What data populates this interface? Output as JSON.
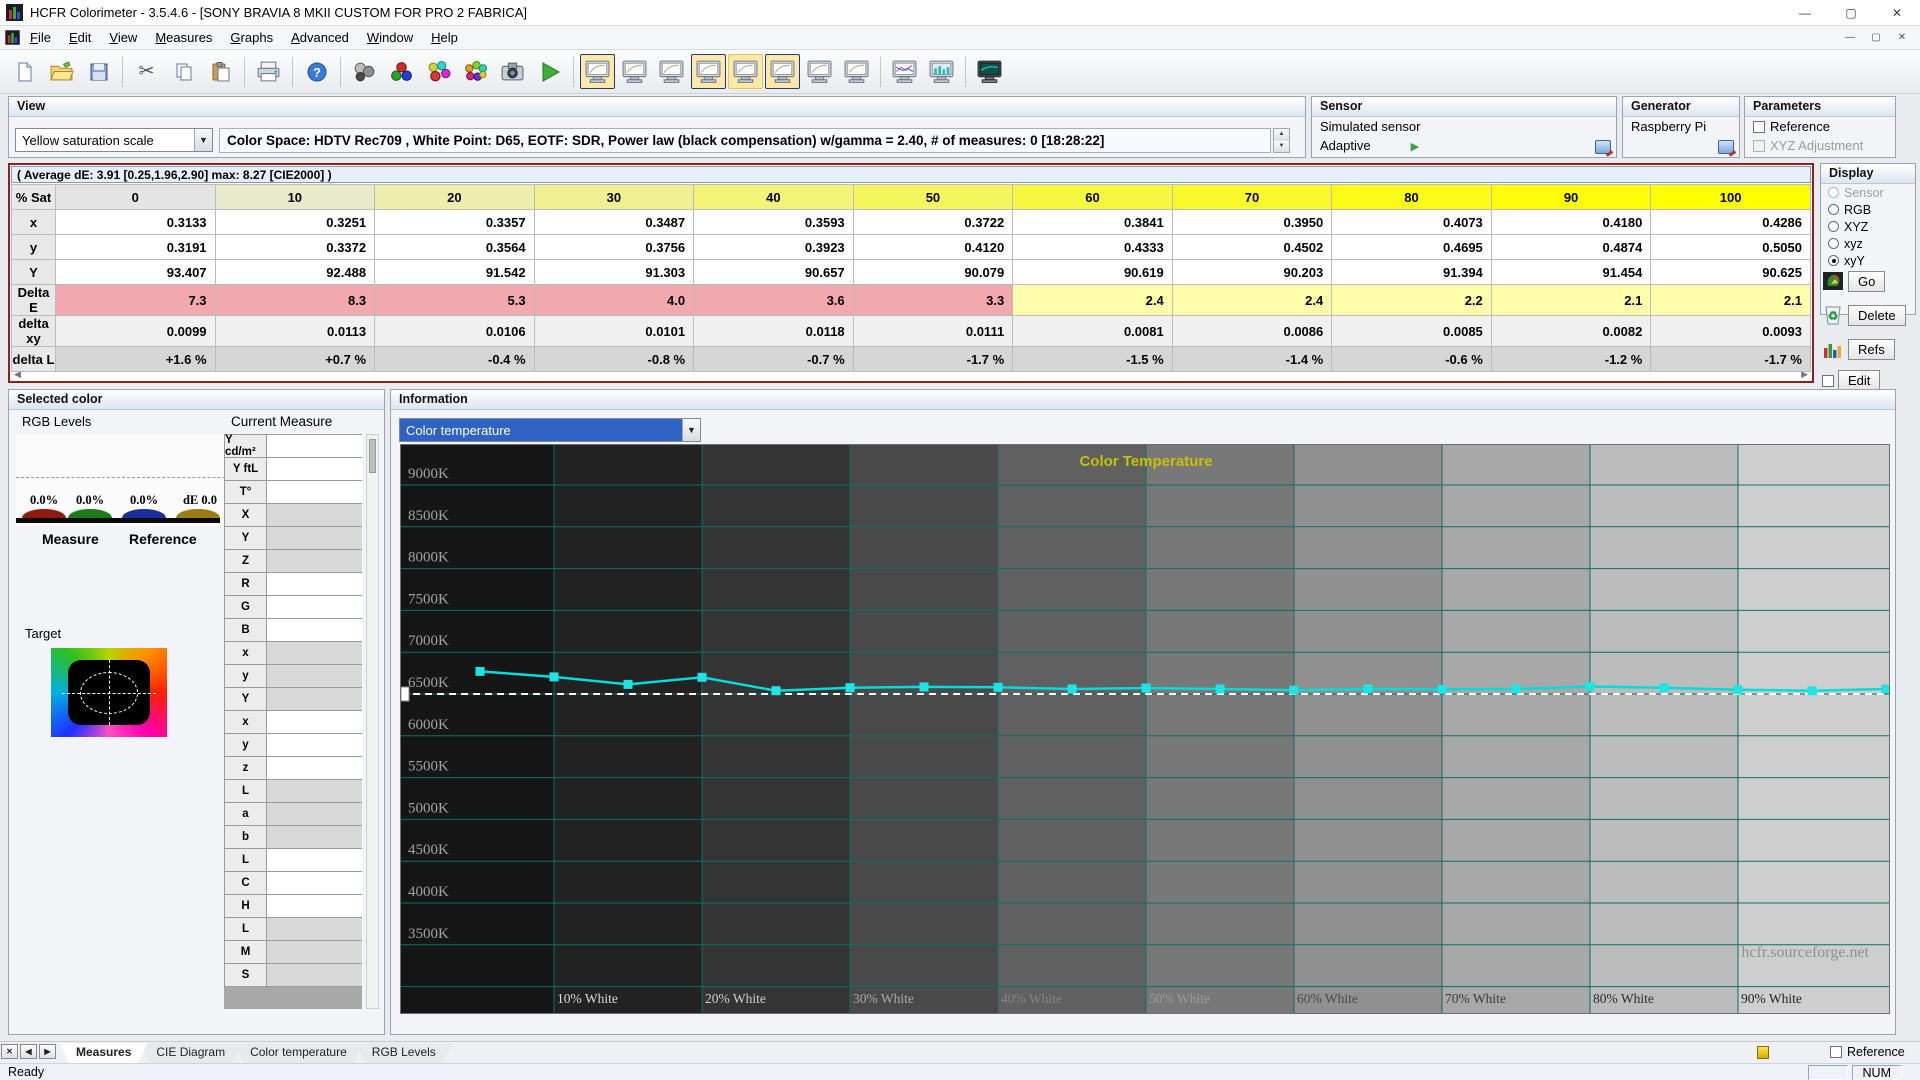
{
  "window": {
    "title": "HCFR Colorimeter - 3.5.4.6 - [SONY BRAVIA 8 MKII CUSTOM FOR PRO 2 FABRICA]",
    "controls": {
      "minimize": "—",
      "maximize": "▢",
      "close": "✕"
    }
  },
  "menu": {
    "items": [
      "File",
      "Edit",
      "View",
      "Measures",
      "Graphs",
      "Advanced",
      "Window",
      "Help"
    ]
  },
  "mdi_controls": {
    "minimize": "—",
    "restore": "▢",
    "close": "✕"
  },
  "toolbar": {
    "buttons": [
      {
        "name": "new-document-icon",
        "type": "doc"
      },
      {
        "name": "open-file-icon",
        "type": "folder"
      },
      {
        "name": "save-icon",
        "type": "save",
        "sep_after": true
      },
      {
        "name": "cut-icon",
        "type": "cut"
      },
      {
        "name": "copy-icon",
        "type": "copy"
      },
      {
        "name": "paste-icon",
        "type": "paste",
        "sep_after": true
      },
      {
        "name": "print-icon",
        "type": "print",
        "sep_after": true
      },
      {
        "name": "help-icon",
        "type": "help",
        "sep_after": true
      },
      {
        "name": "free-measure-icon",
        "type": "balls_grey"
      },
      {
        "name": "primaries-measure-icon",
        "type": "balls_rgb"
      },
      {
        "name": "secondaries-measure-icon",
        "type": "balls_multi"
      },
      {
        "name": "colorchecker-measure-icon",
        "type": "balls_multi2"
      },
      {
        "name": "snapshot-icon",
        "type": "camera"
      },
      {
        "name": "continuous-measure-icon",
        "type": "play",
        "sep_after": true
      },
      {
        "name": "grayscale-view-icon",
        "type": "monitor",
        "hl": true,
        "border": true
      },
      {
        "name": "nearblack-view-icon",
        "type": "monitor"
      },
      {
        "name": "nearwhite-view-icon",
        "type": "monitor"
      },
      {
        "name": "saturation-view-icon",
        "type": "monitor",
        "hl": true,
        "border": true
      },
      {
        "name": "primaries-view-icon",
        "type": "monitor",
        "hl": true
      },
      {
        "name": "measures-grid-view-icon",
        "type": "monitor",
        "hl": true,
        "border": true
      },
      {
        "name": "contrast-view-icon",
        "type": "monitor"
      },
      {
        "name": "info-view-icon",
        "type": "monitor",
        "sep_after": true
      },
      {
        "name": "rgb-levels-view-icon",
        "type": "monitor_chart"
      },
      {
        "name": "luminance-view-icon",
        "type": "monitor_chart2",
        "sep_after": true
      },
      {
        "name": "fullscreen-pattern-icon",
        "type": "monitor_dark"
      }
    ]
  },
  "view_panel": {
    "title": "View",
    "preset": "Yellow saturation scale",
    "info": "Color Space: HDTV Rec709 , White Point: D65, EOTF:  SDR, Power law (black compensation) w/gamma = 2.40, # of measures: 0 [18:28:22]"
  },
  "sensor_panel": {
    "title": "Sensor",
    "line1": "Simulated sensor",
    "line2": "Adaptive"
  },
  "generator_panel": {
    "title": "Generator",
    "line1": "Raspberry Pi"
  },
  "parameters_panel": {
    "title": "Parameters",
    "checkboxes": [
      {
        "label": "Reference",
        "checked": false,
        "enabled": true
      },
      {
        "label": "XYZ Adjustment",
        "checked": false,
        "enabled": false
      }
    ]
  },
  "measures_table": {
    "summary": "( Average dE: 3.91 [0.25,1.96,2.90] max: 8.27 [CIE2000] )",
    "col_header": "% Sat",
    "columns": [
      "0",
      "10",
      "20",
      "30",
      "40",
      "50",
      "60",
      "70",
      "80",
      "90",
      "100"
    ],
    "rows": [
      {
        "label": "x",
        "type": "white",
        "values": [
          "0.3133",
          "0.3251",
          "0.3357",
          "0.3487",
          "0.3593",
          "0.3722",
          "0.3841",
          "0.3950",
          "0.4073",
          "0.4180",
          "0.4286"
        ]
      },
      {
        "label": "y",
        "type": "white",
        "values": [
          "0.3191",
          "0.3372",
          "0.3564",
          "0.3756",
          "0.3923",
          "0.4120",
          "0.4333",
          "0.4502",
          "0.4695",
          "0.4874",
          "0.5050"
        ]
      },
      {
        "label": "Y",
        "type": "white",
        "values": [
          "93.407",
          "92.488",
          "91.542",
          "91.303",
          "90.657",
          "90.079",
          "90.619",
          "90.203",
          "91.394",
          "91.454",
          "90.625"
        ]
      },
      {
        "label": "Delta E",
        "type": "deltaE",
        "values": [
          "7.3",
          "8.3",
          "5.3",
          "4.0",
          "3.6",
          "3.3",
          "2.4",
          "2.4",
          "2.2",
          "2.1",
          "2.1"
        ]
      },
      {
        "label": "delta xy",
        "type": "light",
        "values": [
          "0.0099",
          "0.0113",
          "0.0106",
          "0.0101",
          "0.0118",
          "0.0111",
          "0.0081",
          "0.0086",
          "0.0085",
          "0.0082",
          "0.0093"
        ]
      },
      {
        "label": "delta L",
        "type": "grey",
        "values": [
          "+1.6 %",
          "+0.7 %",
          "-0.4 %",
          "-0.8 %",
          "-0.7 %",
          "-1.7 %",
          "-1.5 %",
          "-1.4 %",
          "-0.6 %",
          "-1.2 %",
          "-1.7 %"
        ]
      }
    ]
  },
  "display_panel": {
    "title": "Display",
    "options": [
      {
        "label": "Sensor",
        "disabled": true
      },
      {
        "label": "RGB"
      },
      {
        "label": "XYZ"
      },
      {
        "label": "xyz"
      },
      {
        "label": "xyY",
        "selected": true
      }
    ]
  },
  "side_buttons": {
    "go": {
      "label": "Go"
    },
    "delete": {
      "label": "Delete"
    },
    "refs": {
      "label": "Refs"
    },
    "edit": {
      "label": "Edit"
    }
  },
  "selected_color": {
    "title": "Selected color",
    "rgb_levels_label": "RGB Levels",
    "current_measure_label": "Current Measure",
    "bar_labels": [
      "0.0%",
      "0.0%",
      "0.0%",
      "dE 0.0"
    ],
    "measure_label": "Measure",
    "reference_label": "Reference",
    "target_label": "Target",
    "measure_rows": [
      "Y cd/m²",
      "Y ftL",
      "T°",
      "X",
      "Y",
      "Z",
      "R",
      "G",
      "B",
      "x",
      "y",
      "Y",
      "x",
      "y",
      "z",
      "L",
      "a",
      "b",
      "L",
      "C",
      "H",
      "L",
      "M",
      "S"
    ]
  },
  "information_panel": {
    "title": "Information",
    "dropdown_value": "Color temperature"
  },
  "chart_data": {
    "type": "line",
    "title": "Color Temperature",
    "title_color": "#c3c300",
    "grid_color": "#0f6e66",
    "watermark": "hcfr.sourceforge.net",
    "reference_kelvin": 6500,
    "y_tick_labels": [
      "9000K",
      "8500K",
      "8000K",
      "7500K",
      "7000K",
      "6500K",
      "6000K",
      "5500K",
      "5000K",
      "4500K",
      "4000K",
      "3500K"
    ],
    "y_tick_values": [
      9000,
      8500,
      8000,
      7500,
      7000,
      6500,
      6000,
      5500,
      5000,
      4500,
      4000,
      3500
    ],
    "x_tick_labels": [
      "10% White",
      "20% White",
      "30% White",
      "40% White",
      "50% White",
      "60% White",
      "70% White",
      "80% White",
      "90% White"
    ],
    "x_tick_values": [
      10,
      20,
      30,
      40,
      50,
      60,
      70,
      80,
      90
    ],
    "ylim_approx": [
      2700,
      9480
    ],
    "series": [
      {
        "name": "Color temperature",
        "color": "#00dcdc",
        "x_percent": [
          5,
          10,
          15,
          20,
          25,
          30,
          35,
          40,
          45,
          50,
          55,
          60,
          65,
          70,
          75,
          80,
          85,
          90,
          95,
          100
        ],
        "kelvin": [
          6770,
          6705,
          6615,
          6700,
          6540,
          6575,
          6585,
          6580,
          6560,
          6570,
          6560,
          6545,
          6560,
          6555,
          6560,
          6590,
          6575,
          6550,
          6540,
          6560
        ]
      }
    ]
  },
  "bottom_tabs": {
    "tabs": [
      {
        "label": "Measures",
        "active": true
      },
      {
        "label": "CIE Diagram"
      },
      {
        "label": "Color temperature"
      },
      {
        "label": "RGB Levels"
      }
    ],
    "reference_label": "Reference"
  },
  "status_bar": {
    "ready": "Ready",
    "num_label": "NUM"
  }
}
